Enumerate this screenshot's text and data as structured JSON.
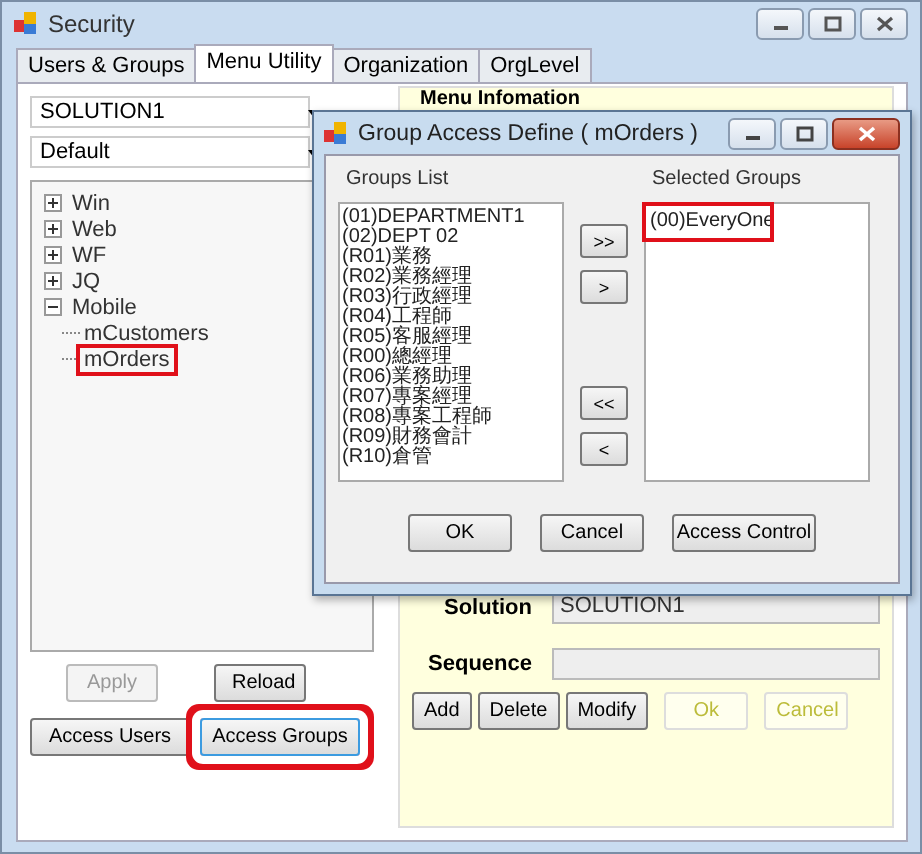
{
  "window": {
    "title": "Security"
  },
  "tabs": [
    {
      "label": "Users & Groups",
      "selected": false
    },
    {
      "label": "Menu Utility",
      "selected": true
    },
    {
      "label": "Organization",
      "selected": false
    },
    {
      "label": "OrgLevel",
      "selected": false
    }
  ],
  "solution_combo": {
    "value": "SOLUTION1"
  },
  "menu_combo": {
    "value": "Default"
  },
  "tree": [
    {
      "label": "Win",
      "expanded": false
    },
    {
      "label": "Web",
      "expanded": false
    },
    {
      "label": "WF",
      "expanded": false
    },
    {
      "label": "JQ",
      "expanded": false
    },
    {
      "label": "Mobile",
      "expanded": true,
      "children": [
        {
          "label": "mCustomers",
          "highlighted": false
        },
        {
          "label": "mOrders",
          "highlighted": true
        }
      ]
    }
  ],
  "left_buttons": [
    {
      "label": "Apply",
      "disabled": true,
      "highlighted": false
    },
    {
      "label": "Reload",
      "disabled": false,
      "highlighted": false
    }
  ],
  "access_buttons": [
    {
      "label": "Access Users",
      "highlighted": false
    },
    {
      "label": "Access Groups",
      "highlighted": true
    }
  ],
  "menu_info": {
    "title": "Menu Infomation",
    "fields": [
      {
        "label": "Solution",
        "value": "SOLUTION1"
      },
      {
        "label": "Sequence"
      }
    ],
    "buttons": [
      {
        "label": "Add",
        "disabled": false
      },
      {
        "label": "Delete",
        "disabled": false
      },
      {
        "label": "Modify",
        "disabled": false
      },
      {
        "label": "Ok",
        "disabled": true
      },
      {
        "label": "Cancel",
        "disabled": true
      }
    ]
  },
  "dialog": {
    "title": "Group Access Define ( mOrders )",
    "groups_label": "Groups List",
    "groups": [
      "(01)DEPARTMENT1",
      "(02)DEPT 02",
      "(R01)業務",
      "(R02)業務經理",
      "(R03)行政經理",
      "(R04)工程師",
      "(R05)客服經理",
      "(R00)總經理",
      "(R06)業務助理",
      "(R07)專案經理",
      "(R08)專案工程師",
      "(R09)財務會計",
      "(R10)倉管"
    ],
    "move_buttons_top": [
      ">>",
      ">"
    ],
    "move_buttons_bottom": [
      "<<",
      "<"
    ],
    "selected_label": "Selected Groups",
    "selected_groups": [
      {
        "label": "(00)EveryOne",
        "highlighted": true
      }
    ],
    "buttons": [
      "OK",
      "Cancel",
      "Access Control"
    ]
  }
}
